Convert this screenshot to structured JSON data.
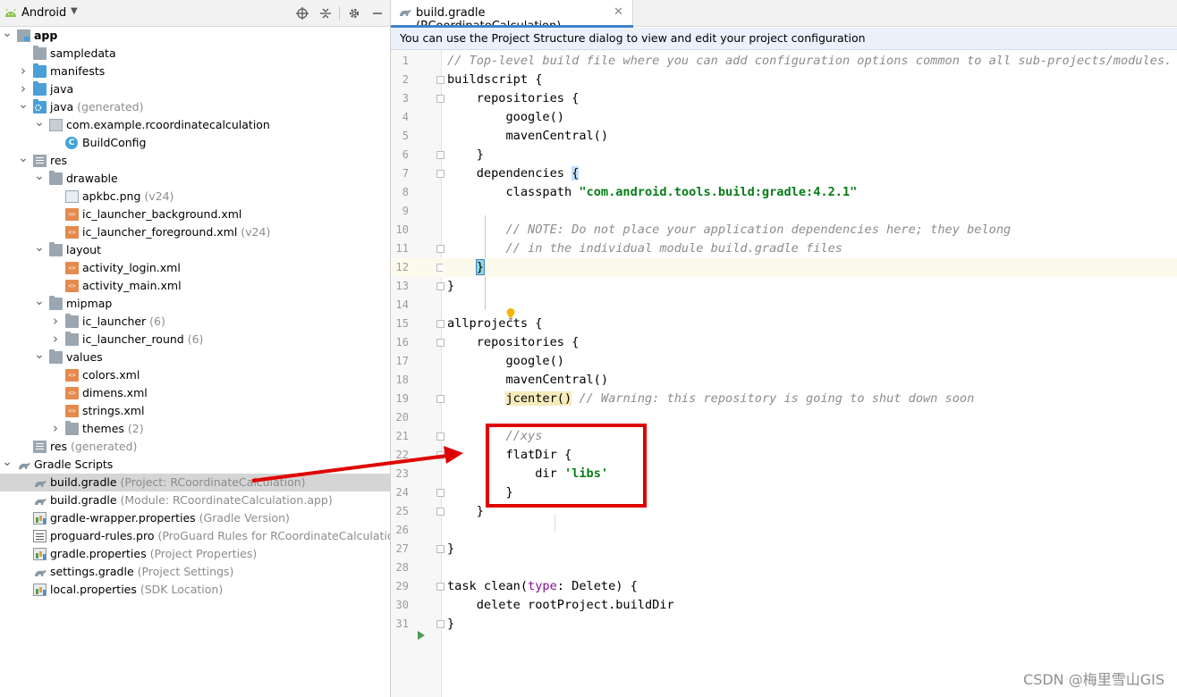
{
  "project_pane": {
    "view_selector": "Android",
    "tree": [
      {
        "label": "app",
        "suffix": "",
        "depth": 0,
        "chevron": "down",
        "icon": "module-icon",
        "bold": true
      },
      {
        "label": "sampledata",
        "suffix": "",
        "depth": 1,
        "chevron": "",
        "icon": "folder-icon"
      },
      {
        "label": "manifests",
        "suffix": "",
        "depth": 1,
        "chevron": "right",
        "icon": "folder-blue-icon"
      },
      {
        "label": "java",
        "suffix": "",
        "depth": 1,
        "chevron": "right",
        "icon": "folder-blue-icon"
      },
      {
        "label": "java",
        "suffix": " (generated)",
        "depth": 1,
        "chevron": "down",
        "icon": "folder-generated-icon"
      },
      {
        "label": "com.example.rcoordinatecalculation",
        "suffix": "",
        "depth": 2,
        "chevron": "down",
        "icon": "package-icon"
      },
      {
        "label": "BuildConfig",
        "suffix": "",
        "depth": 3,
        "chevron": "",
        "icon": "class-icon"
      },
      {
        "label": "res",
        "suffix": "",
        "depth": 1,
        "chevron": "down",
        "icon": "res-folder-icon"
      },
      {
        "label": "drawable",
        "suffix": "",
        "depth": 2,
        "chevron": "down",
        "icon": "folder-icon"
      },
      {
        "label": "apkbc.png",
        "suffix": " (v24)",
        "depth": 3,
        "chevron": "",
        "icon": "png-icon"
      },
      {
        "label": "ic_launcher_background.xml",
        "suffix": "",
        "depth": 3,
        "chevron": "",
        "icon": "xml-icon"
      },
      {
        "label": "ic_launcher_foreground.xml",
        "suffix": " (v24)",
        "depth": 3,
        "chevron": "",
        "icon": "xml-icon"
      },
      {
        "label": "layout",
        "suffix": "",
        "depth": 2,
        "chevron": "down",
        "icon": "folder-icon"
      },
      {
        "label": "activity_login.xml",
        "suffix": "",
        "depth": 3,
        "chevron": "",
        "icon": "xml-icon"
      },
      {
        "label": "activity_main.xml",
        "suffix": "",
        "depth": 3,
        "chevron": "",
        "icon": "xml-icon"
      },
      {
        "label": "mipmap",
        "suffix": "",
        "depth": 2,
        "chevron": "down",
        "icon": "folder-icon"
      },
      {
        "label": "ic_launcher",
        "suffix": " (6)",
        "depth": 3,
        "chevron": "right",
        "icon": "folder-icon"
      },
      {
        "label": "ic_launcher_round",
        "suffix": " (6)",
        "depth": 3,
        "chevron": "right",
        "icon": "folder-icon"
      },
      {
        "label": "values",
        "suffix": "",
        "depth": 2,
        "chevron": "down",
        "icon": "folder-icon"
      },
      {
        "label": "colors.xml",
        "suffix": "",
        "depth": 3,
        "chevron": "",
        "icon": "xml-icon"
      },
      {
        "label": "dimens.xml",
        "suffix": "",
        "depth": 3,
        "chevron": "",
        "icon": "xml-icon"
      },
      {
        "label": "strings.xml",
        "suffix": "",
        "depth": 3,
        "chevron": "",
        "icon": "xml-icon"
      },
      {
        "label": "themes",
        "suffix": " (2)",
        "depth": 3,
        "chevron": "right",
        "icon": "folder-icon"
      },
      {
        "label": "res",
        "suffix": " (generated)",
        "depth": 1,
        "chevron": "",
        "icon": "res-folder-icon"
      },
      {
        "label": "Gradle Scripts",
        "suffix": "",
        "depth": 0,
        "chevron": "down",
        "icon": "gradle-icon"
      },
      {
        "label": "build.gradle",
        "suffix": " (Project: RCoordinateCalculation)",
        "depth": 1,
        "chevron": "",
        "icon": "gradle-icon",
        "selected": true
      },
      {
        "label": "build.gradle",
        "suffix": " (Module: RCoordinateCalculation.app)",
        "depth": 1,
        "chevron": "",
        "icon": "gradle-icon"
      },
      {
        "label": "gradle-wrapper.properties",
        "suffix": " (Gradle Version)",
        "depth": 1,
        "chevron": "",
        "icon": "properties-icon"
      },
      {
        "label": "proguard-rules.pro",
        "suffix": " (ProGuard Rules for RCoordinateCalculation.a",
        "depth": 1,
        "chevron": "",
        "icon": "text-file-icon"
      },
      {
        "label": "gradle.properties",
        "suffix": " (Project Properties)",
        "depth": 1,
        "chevron": "",
        "icon": "properties-icon"
      },
      {
        "label": "settings.gradle",
        "suffix": " (Project Settings)",
        "depth": 1,
        "chevron": "",
        "icon": "gradle-icon"
      },
      {
        "label": "local.properties",
        "suffix": " (SDK Location)",
        "depth": 1,
        "chevron": "",
        "icon": "properties-icon"
      }
    ]
  },
  "editor": {
    "tab_label": "build.gradle (RCoordinateCalculation)",
    "banner": "You can use the Project Structure dialog to view and edit your project configuration",
    "current_line": 12,
    "lines": [
      [
        {
          "t": "// Top-level build file where you can add configuration options common to all sub-projects/modules.",
          "c": "cm"
        }
      ],
      [
        {
          "t": "buildscript {"
        }
      ],
      [
        {
          "t": "    repositories {"
        }
      ],
      [
        {
          "t": "        google()"
        }
      ],
      [
        {
          "t": "        mavenCentral()"
        }
      ],
      [
        {
          "t": "    }"
        }
      ],
      [
        {
          "t": "    dependencies "
        },
        {
          "t": "{",
          "c": "brace-sel"
        }
      ],
      [
        {
          "t": "        classpath "
        },
        {
          "t": "\"com.android.tools.build:gradle:4.2.1\"",
          "c": "str"
        }
      ],
      [
        {
          "t": ""
        }
      ],
      [
        {
          "t": "        "
        },
        {
          "t": "// NOTE: Do not place your application dependencies here; they belong",
          "c": "cm"
        }
      ],
      [
        {
          "t": "        "
        },
        {
          "t": "// in the individual module build.gradle files",
          "c": "cm"
        }
      ],
      [
        {
          "t": "    "
        },
        {
          "t": "}",
          "c": "brace-hl"
        }
      ],
      [
        {
          "t": "}"
        }
      ],
      [
        {
          "t": ""
        }
      ],
      [
        {
          "t": "allprojects {"
        }
      ],
      [
        {
          "t": "    repositories {"
        }
      ],
      [
        {
          "t": "        google()"
        }
      ],
      [
        {
          "t": "        mavenCentral()"
        }
      ],
      [
        {
          "t": "        "
        },
        {
          "t": "jcenter()",
          "c": "warn-hl"
        },
        {
          "t": " "
        },
        {
          "t": "// Warning: this repository is going to shut down soon",
          "c": "cm"
        }
      ],
      [
        {
          "t": ""
        }
      ],
      [
        {
          "t": "        "
        },
        {
          "t": "//xys",
          "c": "cm"
        }
      ],
      [
        {
          "t": "        flatDir {"
        }
      ],
      [
        {
          "t": "            dir "
        },
        {
          "t": "'libs'",
          "c": "str"
        }
      ],
      [
        {
          "t": "        }"
        }
      ],
      [
        {
          "t": "    }"
        }
      ],
      [
        {
          "t": ""
        }
      ],
      [
        {
          "t": "}"
        }
      ],
      [
        {
          "t": ""
        }
      ],
      [
        {
          "t": "task clean("
        },
        {
          "t": "type",
          "c": "kw"
        },
        {
          "t": ": Delete) {"
        }
      ],
      [
        {
          "t": "    delete rootProject.buildDir"
        }
      ],
      [
        {
          "t": "}"
        }
      ]
    ],
    "fold_lines": [
      2,
      3,
      6,
      7,
      11,
      12,
      13,
      15,
      16,
      19,
      21,
      22,
      24,
      25,
      27,
      29,
      31
    ]
  },
  "watermark": "CSDN @梅里雪山GIS",
  "colors": {
    "accent": "#4083c9",
    "annotation_red": "#e00000",
    "string_green": "#067d17",
    "comment_gray": "#8c8c8c",
    "selection_gray": "#d5d5d5"
  }
}
